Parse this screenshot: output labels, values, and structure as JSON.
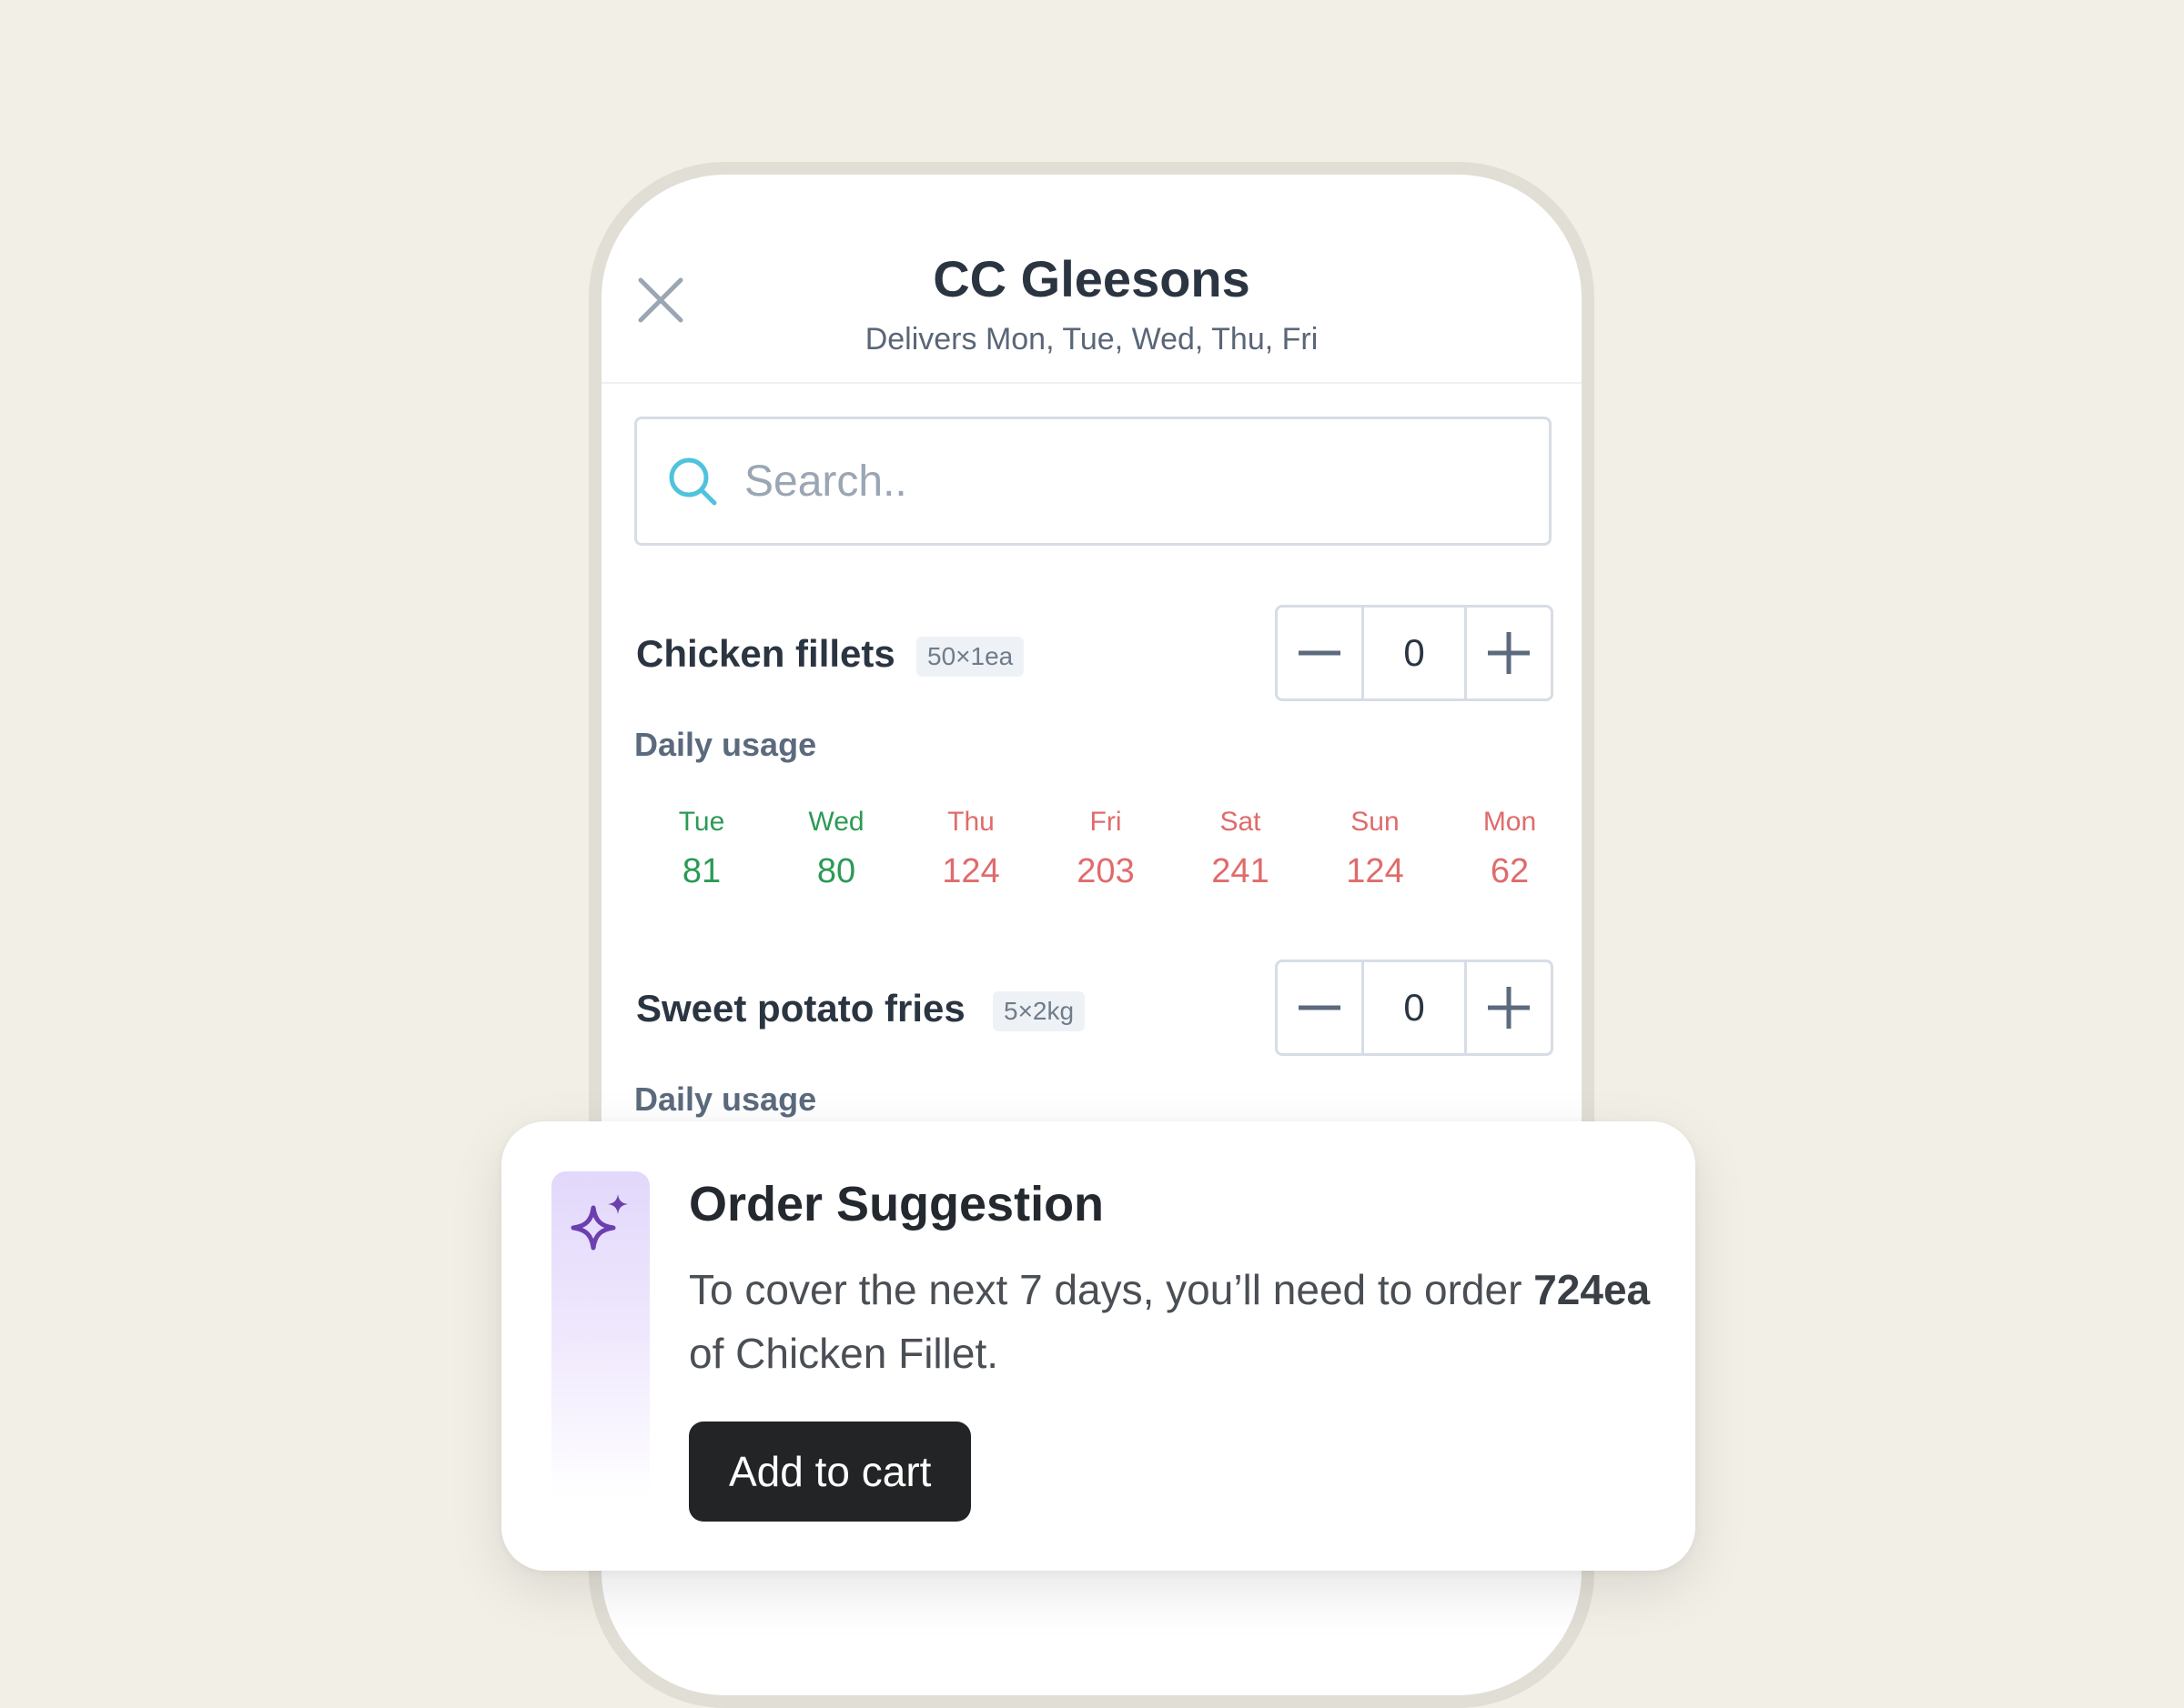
{
  "header": {
    "title": "CC Gleesons",
    "subtitle": "Delivers Mon, Tue, Wed, Thu, Fri"
  },
  "search": {
    "placeholder": "Search.."
  },
  "products": [
    {
      "name": "Chicken fillets",
      "pack": "50×1ea",
      "quantity": "0",
      "usage_label": "Daily usage",
      "usage": [
        {
          "day": "Tue",
          "value": "81",
          "status": "good"
        },
        {
          "day": "Wed",
          "value": "80",
          "status": "good"
        },
        {
          "day": "Thu",
          "value": "124",
          "status": "bad"
        },
        {
          "day": "Fri",
          "value": "203",
          "status": "bad"
        },
        {
          "day": "Sat",
          "value": "241",
          "status": "bad"
        },
        {
          "day": "Sun",
          "value": "124",
          "status": "bad"
        },
        {
          "day": "Mon",
          "value": "62",
          "status": "bad"
        }
      ]
    },
    {
      "name": "Sweet potato fries",
      "pack": "5×2kg",
      "quantity": "0",
      "usage_label": "Daily usage"
    }
  ],
  "suggestion": {
    "title": "Order Suggestion",
    "body_prefix": "To cover the next 7 days, you’ll need to order ",
    "body_amount": "724ea",
    "body_suffix": " of Chicken Fillet.",
    "button": "Add to cart"
  },
  "colors": {
    "good": "#2b9a55",
    "bad": "#e06b6b",
    "accent_purple": "#6b3fb0",
    "search_icon": "#4fc3dd"
  },
  "icons": [
    "close-icon",
    "search-icon",
    "minus-icon",
    "plus-icon",
    "sparkle-icon"
  ]
}
